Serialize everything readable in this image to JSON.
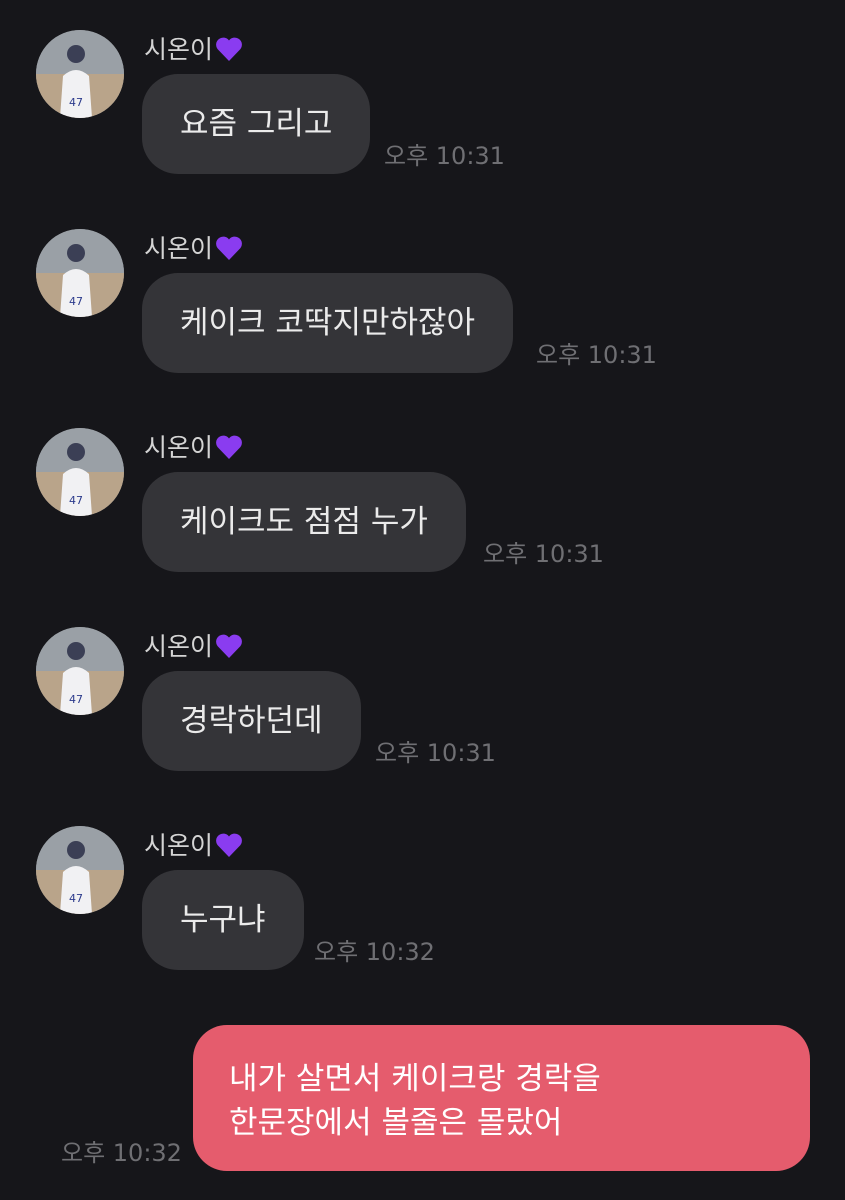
{
  "colors": {
    "background": "#16161a",
    "incoming_bubble": "#343438",
    "outgoing_bubble": "#e55c6d",
    "timestamp": "#6f6f73",
    "heart": "#8a3cf0"
  },
  "messages": [
    {
      "sender": "시온이",
      "sender_icon": "purple-heart-icon",
      "text": "요즘 그리고",
      "time": "오후 10:31"
    },
    {
      "sender": "시온이",
      "sender_icon": "purple-heart-icon",
      "text": "케이크 코딱지만하잖아",
      "time": "오후 10:31"
    },
    {
      "sender": "시온이",
      "sender_icon": "purple-heart-icon",
      "text": "케이크도 점점 누가",
      "time": "오후 10:31"
    },
    {
      "sender": "시온이",
      "sender_icon": "purple-heart-icon",
      "text": "경락하던데",
      "time": "오후 10:31"
    },
    {
      "sender": "시온이",
      "sender_icon": "purple-heart-icon",
      "text": "누구냐",
      "time": "오후 10:32"
    }
  ],
  "my_message": {
    "lines": [
      "내가 살면서 케이크랑 경락을",
      "한문장에서 볼줄은 몰랐어"
    ],
    "time": "오후 10:32"
  }
}
